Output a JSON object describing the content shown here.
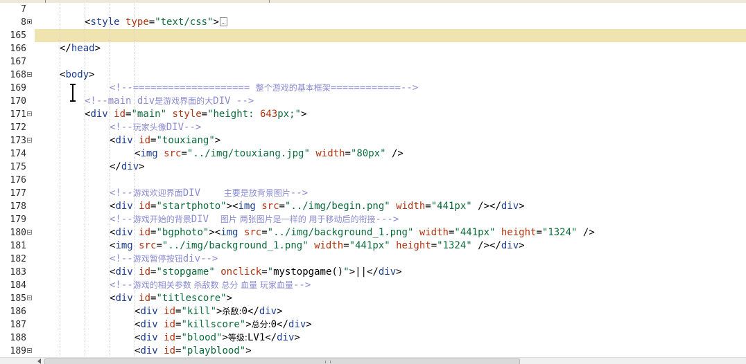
{
  "editor": {
    "highlighted_line": "165",
    "lines": [
      {
        "num": "7",
        "fold": "",
        "indent": 0,
        "tokens": []
      },
      {
        "num": "8",
        "fold": "plus",
        "indent": 2,
        "collapsed": true,
        "tokens": [
          [
            "punct",
            "<"
          ],
          [
            "tag",
            "style"
          ],
          [
            "plain",
            " "
          ],
          [
            "attr",
            "type"
          ],
          [
            "punct",
            "="
          ],
          [
            "str",
            "\"text/css\""
          ],
          [
            "punct",
            ">"
          ]
        ]
      },
      {
        "num": "165",
        "fold": "",
        "indent": 0,
        "tokens": []
      },
      {
        "num": "166",
        "fold": "",
        "indent": 1,
        "tokens": [
          [
            "punct",
            "</"
          ],
          [
            "tag",
            "head"
          ],
          [
            "punct",
            ">"
          ]
        ]
      },
      {
        "num": "167",
        "fold": "",
        "indent": 0,
        "tokens": []
      },
      {
        "num": "168",
        "fold": "minus",
        "indent": 1,
        "tokens": [
          [
            "punct",
            "<"
          ],
          [
            "tag",
            "body"
          ],
          [
            "punct",
            ">"
          ]
        ]
      },
      {
        "num": "169",
        "fold": "",
        "indent": 3,
        "tokens": [
          [
            "com",
            "<!--==================== "
          ],
          [
            "comcn",
            "整个游戏的基本框架"
          ],
          [
            "com",
            "============-->"
          ]
        ]
      },
      {
        "num": "170",
        "fold": "",
        "indent": 2,
        "tokens": [
          [
            "com",
            "<!--main div"
          ],
          [
            "comcn",
            "是游戏界面的大"
          ],
          [
            "com",
            "DIV -->"
          ]
        ]
      },
      {
        "num": "171",
        "fold": "minus",
        "indent": 2,
        "tokens": [
          [
            "punct",
            "<"
          ],
          [
            "tag",
            "div"
          ],
          [
            "plain",
            " "
          ],
          [
            "attr",
            "id"
          ],
          [
            "punct",
            "="
          ],
          [
            "str",
            "\"main\""
          ],
          [
            "plain",
            " "
          ],
          [
            "attr",
            "style"
          ],
          [
            "punct",
            "="
          ],
          [
            "str",
            "\"height: "
          ],
          [
            "attr",
            "643"
          ],
          [
            "str",
            "px;\""
          ],
          [
            "punct",
            ">"
          ]
        ]
      },
      {
        "num": "172",
        "fold": "",
        "indent": 3,
        "tokens": [
          [
            "com",
            "<!--"
          ],
          [
            "comcn",
            "玩家头像"
          ],
          [
            "com",
            "DIV-->"
          ]
        ]
      },
      {
        "num": "173",
        "fold": "minus",
        "indent": 3,
        "tokens": [
          [
            "punct",
            "<"
          ],
          [
            "tag",
            "div"
          ],
          [
            "plain",
            " "
          ],
          [
            "attr",
            "id"
          ],
          [
            "punct",
            "="
          ],
          [
            "str",
            "\"touxiang\""
          ],
          [
            "punct",
            ">"
          ]
        ]
      },
      {
        "num": "174",
        "fold": "",
        "indent": 4,
        "tokens": [
          [
            "punct",
            "<"
          ],
          [
            "tag",
            "img"
          ],
          [
            "plain",
            " "
          ],
          [
            "attr",
            "src"
          ],
          [
            "punct",
            "="
          ],
          [
            "str",
            "\"../img/touxiang.jpg\""
          ],
          [
            "plain",
            " "
          ],
          [
            "attr",
            "width"
          ],
          [
            "punct",
            "="
          ],
          [
            "str",
            "\"80px\""
          ],
          [
            "plain",
            " "
          ],
          [
            "punct",
            "/>"
          ]
        ]
      },
      {
        "num": "175",
        "fold": "",
        "indent": 3,
        "tokens": [
          [
            "punct",
            "</"
          ],
          [
            "tag",
            "div"
          ],
          [
            "punct",
            ">"
          ]
        ]
      },
      {
        "num": "176",
        "fold": "",
        "indent": 0,
        "tokens": []
      },
      {
        "num": "177",
        "fold": "",
        "indent": 3,
        "tokens": [
          [
            "com",
            "<!--"
          ],
          [
            "comcn",
            "游戏欢迎界面"
          ],
          [
            "com",
            "DIV    "
          ],
          [
            "comcn",
            "主要是放背景图片"
          ],
          [
            "com",
            "-->"
          ]
        ]
      },
      {
        "num": "178",
        "fold": "",
        "indent": 3,
        "tokens": [
          [
            "punct",
            "<"
          ],
          [
            "tag",
            "div"
          ],
          [
            "plain",
            " "
          ],
          [
            "attr",
            "id"
          ],
          [
            "punct",
            "="
          ],
          [
            "str",
            "\"startphoto\""
          ],
          [
            "punct",
            ">"
          ],
          [
            "punct",
            "<"
          ],
          [
            "tag",
            "img"
          ],
          [
            "plain",
            " "
          ],
          [
            "attr",
            "src"
          ],
          [
            "punct",
            "="
          ],
          [
            "str",
            "\"../img/begin.png\""
          ],
          [
            "plain",
            " "
          ],
          [
            "attr",
            "width"
          ],
          [
            "punct",
            "="
          ],
          [
            "str",
            "\"441px\""
          ],
          [
            "plain",
            " "
          ],
          [
            "punct",
            "/></"
          ],
          [
            "tag",
            "div"
          ],
          [
            "punct",
            ">"
          ]
        ]
      },
      {
        "num": "179",
        "fold": "",
        "indent": 3,
        "tokens": [
          [
            "com",
            "<!--"
          ],
          [
            "comcn",
            "游戏开始的背景"
          ],
          [
            "com",
            "DIV  "
          ],
          [
            "comcn",
            "图片 两张图片是一样的 用于移动后的衔接"
          ],
          [
            "com",
            "--->"
          ]
        ]
      },
      {
        "num": "180",
        "fold": "minus",
        "indent": 3,
        "tokens": [
          [
            "punct",
            "<"
          ],
          [
            "tag",
            "div"
          ],
          [
            "plain",
            " "
          ],
          [
            "attr",
            "id"
          ],
          [
            "punct",
            "="
          ],
          [
            "str",
            "\"bgphoto\""
          ],
          [
            "punct",
            ">"
          ],
          [
            "punct",
            "<"
          ],
          [
            "tag",
            "img"
          ],
          [
            "plain",
            " "
          ],
          [
            "attr",
            "src"
          ],
          [
            "punct",
            "="
          ],
          [
            "str",
            "\"../img/background_1.png\""
          ],
          [
            "plain",
            " "
          ],
          [
            "attr",
            "width"
          ],
          [
            "punct",
            "="
          ],
          [
            "str",
            "\"441px\""
          ],
          [
            "plain",
            " "
          ],
          [
            "attr",
            "height"
          ],
          [
            "punct",
            "="
          ],
          [
            "str",
            "\"1324\""
          ],
          [
            "plain",
            " "
          ],
          [
            "punct",
            "/>"
          ]
        ]
      },
      {
        "num": "181",
        "fold": "",
        "indent": 3,
        "tokens": [
          [
            "punct",
            "<"
          ],
          [
            "tag",
            "img"
          ],
          [
            "plain",
            " "
          ],
          [
            "attr",
            "src"
          ],
          [
            "punct",
            "="
          ],
          [
            "str",
            "\"../img/background_1.png\""
          ],
          [
            "plain",
            " "
          ],
          [
            "attr",
            "width"
          ],
          [
            "punct",
            "="
          ],
          [
            "str",
            "\"441px\""
          ],
          [
            "plain",
            " "
          ],
          [
            "attr",
            "height"
          ],
          [
            "punct",
            "="
          ],
          [
            "str",
            "\"1324\""
          ],
          [
            "plain",
            " "
          ],
          [
            "punct",
            "/></"
          ],
          [
            "tag",
            "div"
          ],
          [
            "punct",
            ">"
          ]
        ]
      },
      {
        "num": "182",
        "fold": "",
        "indent": 3,
        "tokens": [
          [
            "com",
            "<!--"
          ],
          [
            "comcn",
            "游戏暂停按钮"
          ],
          [
            "com",
            "div-->"
          ]
        ]
      },
      {
        "num": "183",
        "fold": "",
        "indent": 3,
        "tokens": [
          [
            "punct",
            "<"
          ],
          [
            "tag",
            "div"
          ],
          [
            "plain",
            " "
          ],
          [
            "attr",
            "id"
          ],
          [
            "punct",
            "="
          ],
          [
            "str",
            "\"stopgame\""
          ],
          [
            "plain",
            " "
          ],
          [
            "attr",
            "onclick"
          ],
          [
            "punct",
            "="
          ],
          [
            "str",
            "\""
          ],
          [
            "plain",
            "mystopgame()"
          ],
          [
            "str",
            "\""
          ],
          [
            "punct",
            ">"
          ],
          [
            "plain",
            "||"
          ],
          [
            "punct",
            "</"
          ],
          [
            "tag",
            "div"
          ],
          [
            "punct",
            ">"
          ]
        ]
      },
      {
        "num": "184",
        "fold": "",
        "indent": 3,
        "tokens": [
          [
            "com",
            "<!--"
          ],
          [
            "comcn",
            "游戏的相关参数 杀敌数 总分 血量 玩家血量"
          ],
          [
            "com",
            "-->"
          ]
        ]
      },
      {
        "num": "185",
        "fold": "minus",
        "indent": 3,
        "tokens": [
          [
            "punct",
            "<"
          ],
          [
            "tag",
            "div"
          ],
          [
            "plain",
            " "
          ],
          [
            "attr",
            "id"
          ],
          [
            "punct",
            "="
          ],
          [
            "str",
            "\"titlescore\""
          ],
          [
            "punct",
            ">"
          ]
        ]
      },
      {
        "num": "186",
        "fold": "",
        "indent": 4,
        "tokens": [
          [
            "punct",
            "<"
          ],
          [
            "tag",
            "div"
          ],
          [
            "plain",
            " "
          ],
          [
            "attr",
            "id"
          ],
          [
            "punct",
            "="
          ],
          [
            "str",
            "\"kill\""
          ],
          [
            "punct",
            ">"
          ],
          [
            "plaincn",
            "杀敌:"
          ],
          [
            "plain",
            "0"
          ],
          [
            "punct",
            "</"
          ],
          [
            "tag",
            "div"
          ],
          [
            "punct",
            ">"
          ]
        ]
      },
      {
        "num": "187",
        "fold": "",
        "indent": 4,
        "tokens": [
          [
            "punct",
            "<"
          ],
          [
            "tag",
            "div"
          ],
          [
            "plain",
            " "
          ],
          [
            "attr",
            "id"
          ],
          [
            "punct",
            "="
          ],
          [
            "str",
            "\"killscore\""
          ],
          [
            "punct",
            ">"
          ],
          [
            "plaincn",
            "总分:"
          ],
          [
            "plain",
            "0"
          ],
          [
            "punct",
            "</"
          ],
          [
            "tag",
            "div"
          ],
          [
            "punct",
            ">"
          ]
        ]
      },
      {
        "num": "188",
        "fold": "",
        "indent": 4,
        "tokens": [
          [
            "punct",
            "<"
          ],
          [
            "tag",
            "div"
          ],
          [
            "plain",
            " "
          ],
          [
            "attr",
            "id"
          ],
          [
            "punct",
            "="
          ],
          [
            "str",
            "\"blood\""
          ],
          [
            "punct",
            ">"
          ],
          [
            "plaincn",
            "等级:"
          ],
          [
            "plain",
            "LV1"
          ],
          [
            "punct",
            "</"
          ],
          [
            "tag",
            "div"
          ],
          [
            "punct",
            ">"
          ]
        ]
      },
      {
        "num": "189",
        "fold": "minus",
        "indent": 4,
        "tokens": [
          [
            "punct",
            "<"
          ],
          [
            "tag",
            "div"
          ],
          [
            "plain",
            " "
          ],
          [
            "attr",
            "id"
          ],
          [
            "punct",
            "="
          ],
          [
            "str",
            "\"playblood\""
          ],
          [
            "punct",
            ">"
          ]
        ]
      }
    ]
  },
  "icons": {
    "fold_collapsed": "collapsed-fold-ellipsis-icon",
    "text_cursor": "ibeam-cursor-icon",
    "scroll_left": "scroll-left-arrow-icon"
  },
  "colors": {
    "current_line": "#efe3b0",
    "tag": "#1a3d8f",
    "attribute": "#b0320f",
    "string": "#0b6b3a",
    "comment": "#8a8ad2"
  }
}
